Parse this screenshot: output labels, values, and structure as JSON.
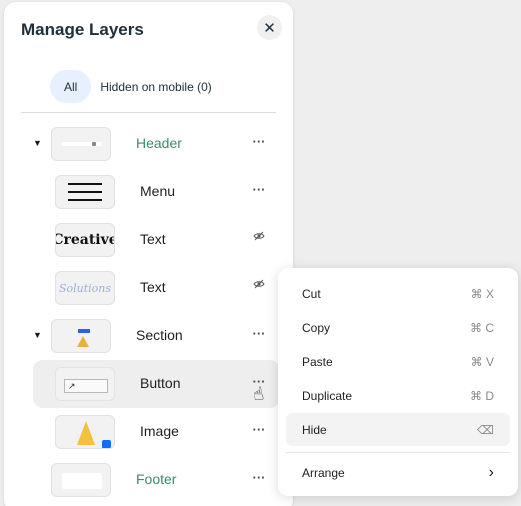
{
  "panel": {
    "title": "Manage Layers",
    "close_icon": "close-icon",
    "tabs": [
      {
        "label": "All",
        "active": true
      },
      {
        "label": "Hidden on mobile (0)",
        "active": false
      }
    ]
  },
  "layers": [
    {
      "label": "Header",
      "thumbnail": "header-thumbnail",
      "color": "#3c8c64",
      "expanded": true,
      "action": "more-options-icon"
    },
    {
      "label": "Menu",
      "thumbnail": "menu-thumbnail",
      "action": "more-options-icon"
    },
    {
      "label": "Text",
      "thumbnail": "text-creative-thumbnail",
      "action": "eye-hidden-icon"
    },
    {
      "label": "Text",
      "thumbnail": "text-solutions-thumbnail",
      "action": "eye-hidden-icon"
    },
    {
      "label": "Section",
      "thumbnail": "section-thumbnail",
      "expanded": true,
      "action": "more-options-icon"
    },
    {
      "label": "Button",
      "thumbnail": "button-thumbnail",
      "highlighted": true,
      "action": "more-options-icon"
    },
    {
      "label": "Image",
      "thumbnail": "image-thumbnail",
      "action": "more-options-icon"
    },
    {
      "label": "Footer",
      "thumbnail": "footer-thumbnail",
      "color": "#3c8c64",
      "action": "more-options-icon"
    }
  ],
  "thumbnails": {
    "creative_text": "Creative",
    "solutions_text": "Solutions"
  },
  "context_menu": {
    "items": [
      {
        "label": "Cut",
        "shortcut": "⌘ X"
      },
      {
        "label": "Copy",
        "shortcut": "⌘ C"
      },
      {
        "label": "Paste",
        "shortcut": "⌘ V"
      },
      {
        "label": "Duplicate",
        "shortcut": "⌘ D"
      },
      {
        "label": "Hide",
        "shortcut": "⌫",
        "active": true
      },
      {
        "label": "Arrange",
        "shortcut": "›"
      }
    ]
  }
}
